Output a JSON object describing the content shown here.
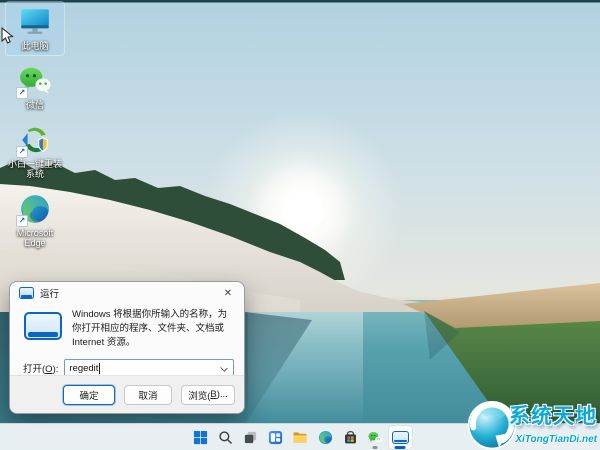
{
  "desktop": {
    "shortcut_arrow": "↗",
    "icons": [
      {
        "label": "此电脑",
        "selected": true
      },
      {
        "label": "微信",
        "selected": false
      },
      {
        "label": "小白一键重装系统",
        "selected": false
      },
      {
        "label": "Microsoft Edge",
        "selected": false
      }
    ]
  },
  "run_dialog": {
    "title": "运行",
    "description": "Windows 将根据你所输入的名称，为你打开相应的程序、文件夹、文档或 Internet 资源。",
    "open_label": {
      "prefix": "打开(",
      "access_key": "O",
      "suffix": "):"
    },
    "input_value": "regedit",
    "buttons": {
      "ok": "确定",
      "cancel": "取消",
      "browse": {
        "prefix": "浏览(",
        "access_key": "B",
        "suffix": ")..."
      }
    },
    "close_icon": "✕"
  },
  "taskbar": {
    "items": [
      {
        "name": "start",
        "icon": "windows-logo"
      },
      {
        "name": "search",
        "icon": "magnifier"
      },
      {
        "name": "task-view",
        "icon": "overlapping-squares"
      },
      {
        "name": "widgets",
        "icon": "widgets-panel"
      },
      {
        "name": "file-explorer",
        "icon": "folder"
      },
      {
        "name": "edge",
        "icon": "edge-swirl"
      },
      {
        "name": "store",
        "icon": "shopping-bag"
      },
      {
        "name": "wechat",
        "icon": "chat-bubbles",
        "state": "open"
      },
      {
        "name": "run",
        "icon": "run-window",
        "state": "active"
      }
    ]
  },
  "watermark": {
    "title": "系统天地",
    "url": "XiTongTianDi.net",
    "accent_color": "#0aa9d9"
  },
  "colors": {
    "accent_blue": "#0067c0",
    "water_teal": "#4c9fae",
    "taskbar_bg": "#f1f4f8",
    "watermark_cyan": "#0aa9d9"
  }
}
